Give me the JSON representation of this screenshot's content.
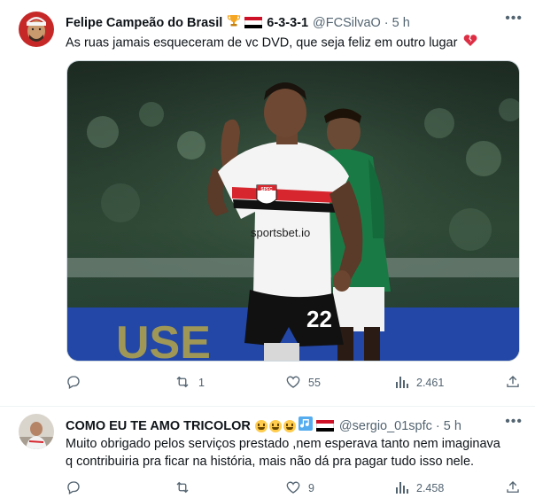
{
  "tweets": [
    {
      "display_name": "Felipe Campeão do Brasil",
      "name_suffix": "6-3-3-1",
      "handle": "@FCSilvaO",
      "time": "5 h",
      "text": "As ruas jamais esqueceram de vc DVD, que seja feliz em outro lugar",
      "image_text": {
        "shirt_brand": "sportsbet.io",
        "shirt_number": "22",
        "badge": "SPFC",
        "board": "USE"
      },
      "stats": {
        "replies": "",
        "retweets": "1",
        "likes": "55",
        "views": "2.461"
      }
    },
    {
      "display_name": "COMO EU TE AMO TRICOLOR",
      "handle": "@sergio_01spfc",
      "time": "5 h",
      "text_lines": [
        "Muito obrigado pelos serviços prestado ,nem esperava tanto nem  imaginava",
        "q contribuiria pra ficar na história, mais não dá pra pagar tudo isso nele."
      ],
      "stats": {
        "replies": "",
        "retweets": "",
        "likes": "9",
        "views": "2.458"
      }
    }
  ],
  "icons": [
    "trophy-icon",
    "egypt-flag-icon",
    "more-icon",
    "reply-icon",
    "retweet-icon",
    "like-icon",
    "views-icon",
    "share-icon",
    "broken-heart-icon",
    "music-note-icon",
    "grinning-face-icon"
  ],
  "colors": {
    "text": "#0f1419",
    "secondary": "#536471",
    "divider": "#eff3f4"
  }
}
